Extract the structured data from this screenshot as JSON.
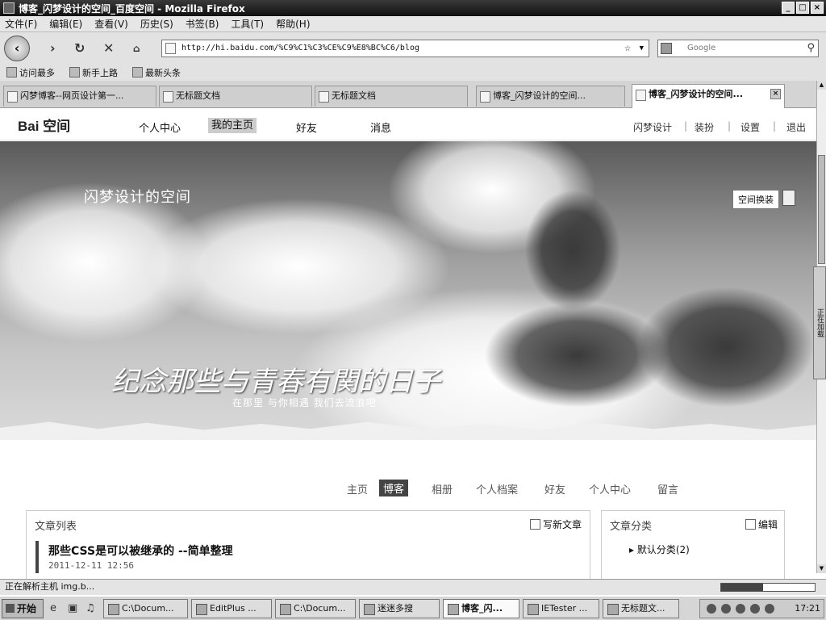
{
  "window": {
    "title": "博客_闪梦设计的空间_百度空间 - Mozilla Firefox",
    "buttons": [
      "_",
      "□",
      "×"
    ]
  },
  "menu": [
    "文件(F)",
    "编辑(E)",
    "查看(V)",
    "历史(S)",
    "书签(B)",
    "工具(T)",
    "帮助(H)"
  ],
  "nav": {
    "url": "http://hi.baidu.com/%C9%C1%C3%CE%C9%E8%BC%C6/blog",
    "search_placeholder": "Google",
    "icons": [
      "back-icon",
      "forward-icon",
      "reload-icon",
      "stop-icon",
      "home-icon"
    ]
  },
  "bookmarks": [
    "访问最多",
    "新手上路",
    "最新头条"
  ],
  "tabs": [
    {
      "label": "闪梦博客--网页设计第一..."
    },
    {
      "label": "无标题文档"
    },
    {
      "label": "无标题文档"
    },
    {
      "label": "博客_闪梦设计的空间..."
    },
    {
      "label": "博客_闪梦设计的空间..."
    }
  ],
  "site": {
    "logo": "Bai 空间",
    "nav": [
      "个人中心",
      "我的主页",
      "好友",
      "消息"
    ],
    "right": [
      "闪梦设计",
      "装扮",
      "设置",
      "退出"
    ]
  },
  "banner": {
    "title": "闪梦设计的空间",
    "skin_button": "空间换装",
    "slogan": "纪念那些与青春有関的日子",
    "subslogan": "在那里 与你相遇 我们去流浪吧"
  },
  "blog_nav": [
    "主页",
    "博客",
    "相册",
    "个人档案",
    "好友",
    "个人中心",
    "留言"
  ],
  "articles": {
    "header": "文章列表",
    "write": "写新文章",
    "posts": [
      {
        "title": "那些CSS是可以被继承的 --简单整理",
        "date": "2011-12-11 12:56"
      }
    ]
  },
  "categories": {
    "header": "文章分类",
    "edit": "编辑",
    "items": [
      "默认分类(2)"
    ]
  },
  "sidebar_tab": "正在加载",
  "status": {
    "text": "正在解析主机 img.b...",
    "progress": 0.45
  },
  "taskbar": {
    "start": "开始",
    "tasks": [
      "C:\\Docum...",
      "EditPlus ...",
      "C:\\Docum...",
      "迷迷多搜",
      "博客_闪...",
      "IETester ...",
      "无标题文..."
    ],
    "clock": "17:21"
  }
}
